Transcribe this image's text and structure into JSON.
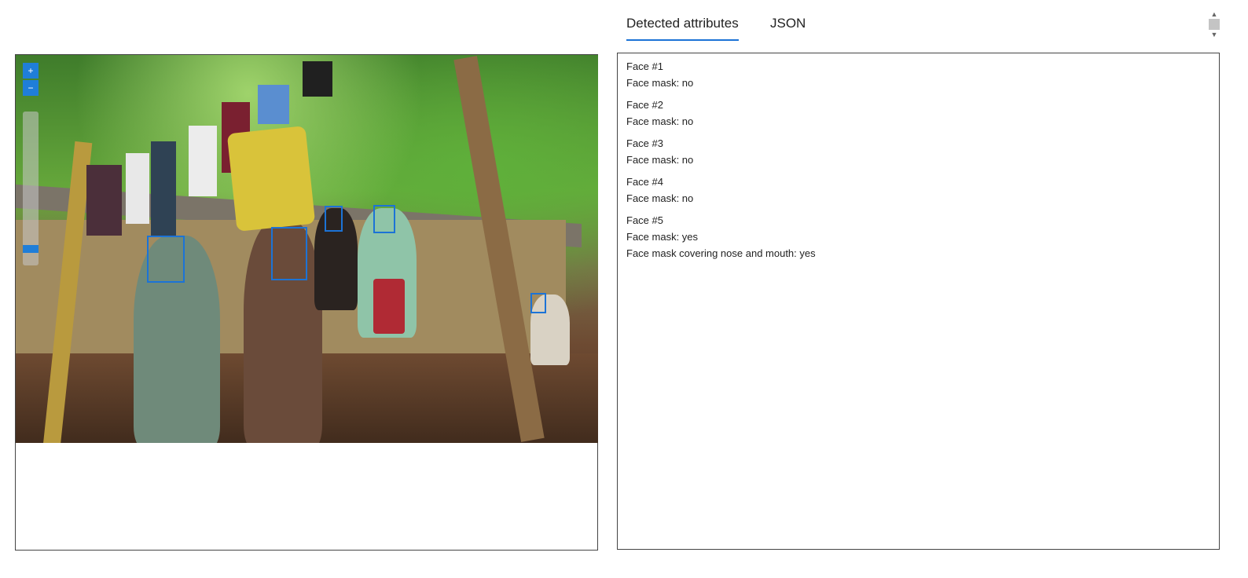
{
  "tabs": [
    {
      "label": "Detected attributes",
      "active": true
    },
    {
      "label": "JSON",
      "active": false
    }
  ],
  "image_viewer": {
    "zoom_in_icon": "plus-icon",
    "zoom_out_icon": "minus-icon",
    "zoom_level": 0.0
  },
  "faces": [
    {
      "title": "Face #1",
      "lines": [
        "Face mask: no"
      ]
    },
    {
      "title": "Face #2",
      "lines": [
        "Face mask: no"
      ]
    },
    {
      "title": "Face #3",
      "lines": [
        "Face mask: no"
      ]
    },
    {
      "title": "Face #4",
      "lines": [
        "Face mask: no"
      ]
    },
    {
      "title": "Face #5",
      "lines": [
        "Face mask: yes",
        "Face mask covering nose and mouth: yes"
      ]
    }
  ],
  "colors": {
    "accent": "#1c73d6",
    "face_box": "#1c73d6"
  }
}
